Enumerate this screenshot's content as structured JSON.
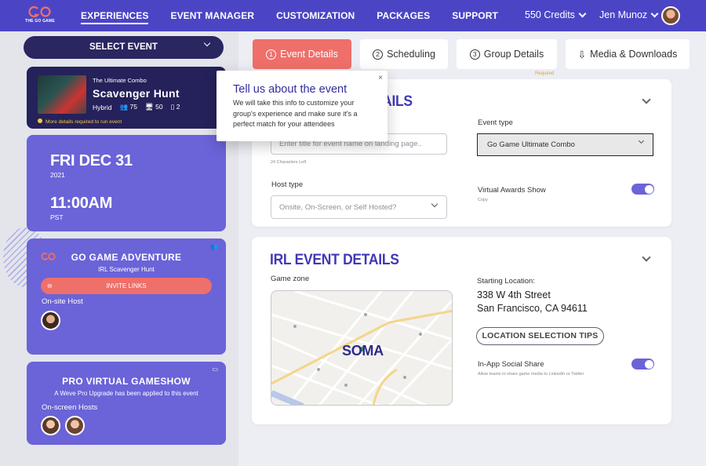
{
  "brand": {
    "logo_text": "THE GO GAME"
  },
  "nav": [
    "EXPERIENCES",
    "EVENT MANAGER",
    "CUSTOMIZATION",
    "PACKAGES",
    "SUPPORT"
  ],
  "header": {
    "credits": "550 Credits",
    "user": "Jen Munoz"
  },
  "sidebar": {
    "select_event": "SELECT EVENT",
    "current": {
      "subtitle": "The Ultimate Combo",
      "title": "Scavenger Hunt",
      "mode": "Hybrid",
      "players": "75",
      "screens": "50",
      "rooms": "2",
      "warning": "More details required to run event"
    },
    "date": {
      "day": "FRI DEC 31",
      "year": "2021",
      "time": "11:00AM",
      "tz": "PST"
    },
    "adventure": {
      "title": "GO GAME ADVENTURE",
      "subtitle": "IRL Scavenger Hunt",
      "invite": "INVITE LINKS",
      "host_label": "On-site Host"
    },
    "pro": {
      "title": "PRO VIRTUAL GAMESHOW",
      "subtitle": "A Weve Pro Upgrade has been applied to this event",
      "host_label": "On-screen Hosts"
    }
  },
  "tabs": [
    {
      "num": "1",
      "label": "Event Details"
    },
    {
      "num": "2",
      "label": "Scheduling"
    },
    {
      "num": "3",
      "label": "Group Details"
    },
    {
      "label": "Media & Downloads"
    }
  ],
  "required": "Required",
  "details": {
    "title_visible": "TAILS",
    "name_placeholder": "Enter title for event name on landing page..",
    "chars_left": "24 Characters Left",
    "event_type_label": "Event type",
    "event_type_value": "Go Game Ultimate Combo",
    "host_type_label": "Host type",
    "host_type_placeholder": "Onsite, On-Screen, or Self Hosted?",
    "awards_label": "Virtual Awards Show",
    "awards_sub": "Copy"
  },
  "irl": {
    "title": "IRL EVENT DETAILS",
    "zone_label": "Game zone",
    "zone_name": "SOMA",
    "start_label": "Starting Location:",
    "address_line1": "338 W 4th Street",
    "address_line2": "San Francisco, CA 94611",
    "tips_button": "LOCATION SELECTION TIPS",
    "social_label": "In-App Social Share",
    "social_sub": "Allow teams to share game media to LinkedIn or Twitter"
  },
  "tooltip": {
    "title": "Tell us about the event",
    "body": "We will take this info to customize your group's experience and make sure it's a perfect match for your attendees",
    "close": "×"
  },
  "colors": {
    "primary": "#4b45c6",
    "accent": "#ef6f6a",
    "card": "#6b63d8",
    "dark": "#25215a"
  }
}
